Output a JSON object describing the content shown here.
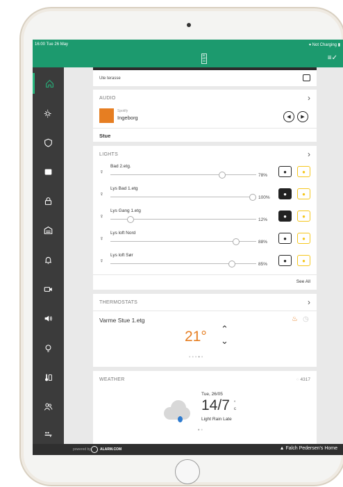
{
  "status_bar": {
    "time": "16:00  Tue 26 May",
    "charging": "Not Charging"
  },
  "header": {
    "logo": "AL AR M",
    "action_icon": "menu-check-icon"
  },
  "sidebar": {
    "items": [
      {
        "name": "home",
        "icon": "home-icon",
        "active": true
      },
      {
        "name": "scenes",
        "icon": "sun-moon-icon"
      },
      {
        "name": "security",
        "icon": "shield-icon"
      },
      {
        "name": "images",
        "icon": "image-icon"
      },
      {
        "name": "locks",
        "icon": "lock-icon"
      },
      {
        "name": "garage",
        "icon": "garage-icon"
      },
      {
        "name": "notifications",
        "icon": "bell-icon"
      },
      {
        "name": "video",
        "icon": "camera-icon"
      },
      {
        "name": "audio",
        "icon": "speaker-icon"
      },
      {
        "name": "lights",
        "icon": "bulb-icon"
      },
      {
        "name": "thermostats",
        "icon": "thermometer-icon"
      },
      {
        "name": "users",
        "icon": "users-icon"
      },
      {
        "name": "settings",
        "icon": "settings-icon"
      }
    ]
  },
  "camera_card": {
    "label": "Ute terasse"
  },
  "audio": {
    "title": "AUDIO",
    "source": "Spotify",
    "track": "Ingeborg",
    "room": "Stue"
  },
  "lights": {
    "title": "LIGHTS",
    "items": [
      {
        "name": "Bad 2.etg.",
        "pct": "78%",
        "level": 0.78,
        "dark_off": false
      },
      {
        "name": "Lys Bad 1.etg",
        "pct": "100%",
        "level": 1.0,
        "dark_off": true
      },
      {
        "name": "Lys Gang 1.etg",
        "pct": "12%",
        "level": 0.12,
        "dark_off": true
      },
      {
        "name": "Lys loft Nord",
        "pct": "88%",
        "level": 0.88,
        "dark_off": false
      },
      {
        "name": "Lys loft Sør",
        "pct": "85%",
        "level": 0.85,
        "dark_off": false
      }
    ],
    "see_all": "See All"
  },
  "thermostats": {
    "title": "THERMOSTATS",
    "name": "Varme Stue 1.etg",
    "temp": "21°"
  },
  "weather": {
    "title": "WEATHER",
    "location": "4317",
    "date": "Tue, 26/05",
    "temp_hi": "14",
    "temp_sep": "/",
    "temp_lo": "7",
    "unit_deg": "°",
    "unit_c": "c",
    "condition": "Light Rain Late"
  },
  "footer": {
    "powered": "powered by",
    "brand": "ALARM.COM",
    "home": "Falch Pedersen's Home"
  },
  "colors": {
    "brand": "#1c9a6e",
    "accent_orange": "#e67e22",
    "bulb_yellow": "#f5c61b"
  }
}
